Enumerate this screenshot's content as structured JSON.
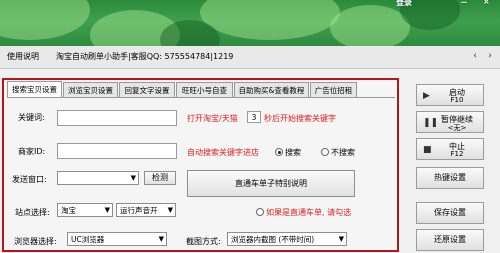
{
  "header": {
    "login_label": "登录",
    "minimize_label": "－",
    "close_label": "×"
  },
  "menu": {
    "help_label": "使用说明",
    "title_text": "淘宝自动刷单小助手|客服QQ: 575554784|1219",
    "prev_label": "‹",
    "next_label": "›"
  },
  "tabs": [
    {
      "label": "搜索宝贝设置",
      "active": true
    },
    {
      "label": "浏览宝贝设置",
      "active": false
    },
    {
      "label": "回复文字设置",
      "active": false
    },
    {
      "label": "旺旺小号自查",
      "active": false
    },
    {
      "label": "自助购买&查看教程",
      "active": false
    },
    {
      "label": "广告位招租",
      "active": false
    }
  ],
  "form": {
    "keyword_label": "关键词:",
    "keyword_value": "",
    "open_hint_before": "打开淘宝/天猫",
    "seconds_value": "3",
    "open_hint_after": "秒后开始搜索关键字",
    "shop_label": "商家ID:",
    "shop_value": "",
    "auto_shop_hint": "自动搜索关键字进店",
    "radio_search": "搜索",
    "radio_no_search": "不搜索",
    "send_window_label": "发送窗口:",
    "send_window_value": "",
    "detect_button": "检测",
    "train_button": "直通车单子特别说明",
    "site_label": "站点选择:",
    "site_value": "淘宝",
    "sound_value": "运行声音开",
    "train_checkbox_label": "如果是直通车单, 请勾选",
    "browser_label": "浏览器选择:",
    "browser_value": "UC浏览器",
    "screenshot_label": "截图方式:",
    "screenshot_value": "浏览器内截图 (不带时间)"
  },
  "right_panel": {
    "start_label": "启动",
    "start_key": "F10",
    "pause_label": "暂停继续",
    "pause_key": "<无>",
    "stop_label": "中止",
    "stop_key": "F12",
    "hotkey_label": "热键设置",
    "save_label": "保存设置",
    "restore_label": "还原设置"
  },
  "colors": {
    "header_green": "#2f8f3f",
    "panel_border": "#b2151b",
    "hint_red": "#e02020"
  }
}
